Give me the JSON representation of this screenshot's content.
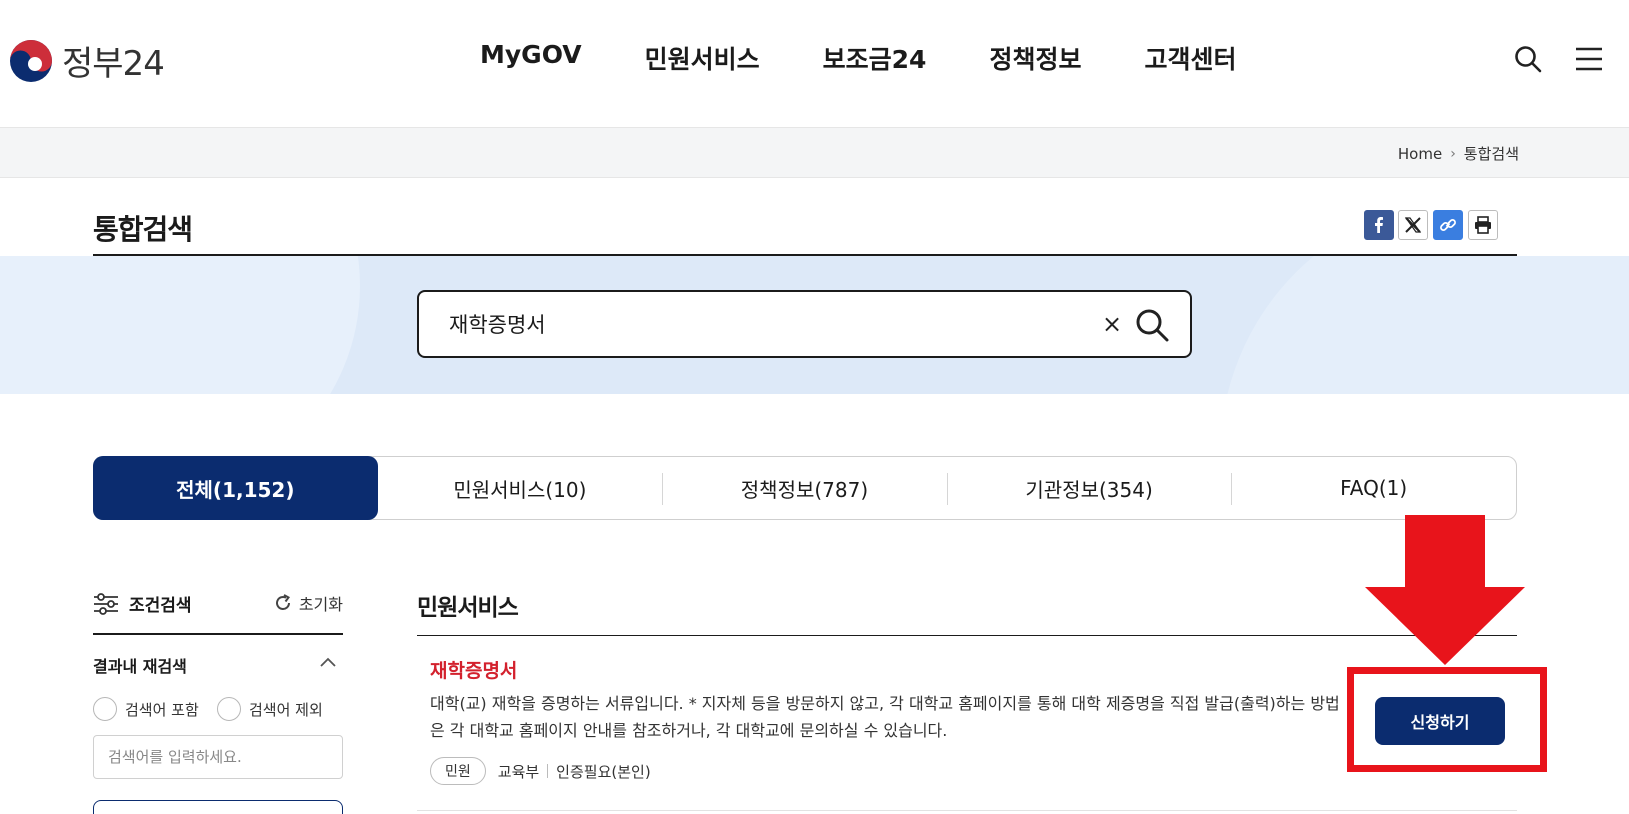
{
  "header": {
    "logo_text": "정부24",
    "nav": [
      "MyGOV",
      "민원서비스",
      "보조금24",
      "정책정보",
      "고객센터"
    ]
  },
  "breadcrumb": {
    "home": "Home",
    "current": "통합검색"
  },
  "page": {
    "title": "통합검색"
  },
  "search": {
    "value": "재학증명서",
    "clear_symbol": "×"
  },
  "tabs": [
    {
      "label": "전체(1,152)",
      "active": true
    },
    {
      "label": "민원서비스(10)",
      "active": false
    },
    {
      "label": "정책정보(787)",
      "active": false
    },
    {
      "label": "기관정보(354)",
      "active": false
    },
    {
      "label": "FAQ(1)",
      "active": false
    }
  ],
  "filter": {
    "title": "조건검색",
    "reset_label": "초기화",
    "refine_label": "결과내 재검색",
    "include_label": "검색어 포함",
    "exclude_label": "검색어 제외",
    "input_placeholder": "검색어를 입력하세요."
  },
  "results": {
    "section_title": "민원서비스",
    "items": [
      {
        "title": "재학증명서",
        "description": "대학(교) 재학을 증명하는 서류입니다. * 지자체 등을 방문하지 않고, 각 대학교 홈페이지를 통해 대학 제증명을 직접 발급(출력)하는 방법은 각 대학교 홈페이지 안내를 참조하거나, 각 대학교에 문의하실 수 있습니다.",
        "badge": "민원",
        "agency": "교육부",
        "auth": "인증필요(본인)",
        "action_label": "신청하기"
      }
    ]
  },
  "colors": {
    "primary_navy": "#0b2c6f",
    "result_title_red": "#d3212d",
    "annotation_red": "#e8141b",
    "search_band": "#dde9f8"
  },
  "icons": {
    "header": [
      "search-icon",
      "hamburger-menu-icon"
    ],
    "share": [
      "facebook-icon",
      "x-twitter-icon",
      "link-icon",
      "print-icon"
    ]
  }
}
